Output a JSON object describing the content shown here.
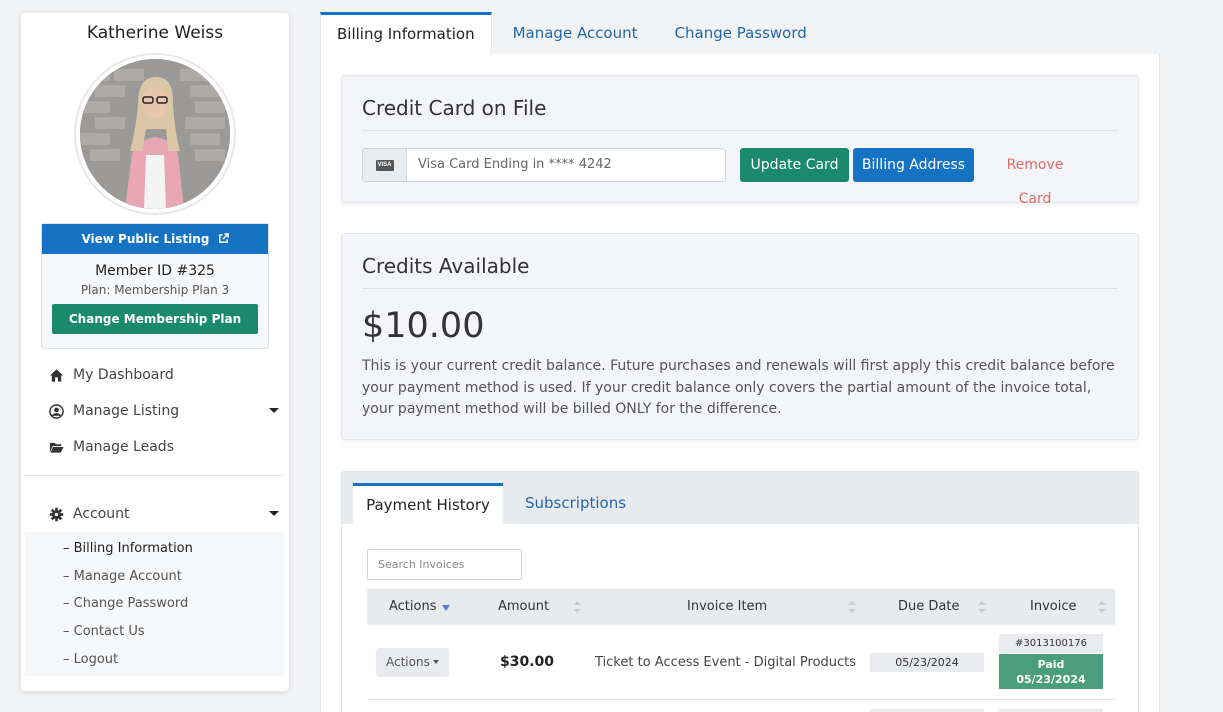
{
  "profile": {
    "name": "Katherine Weiss",
    "view_public_label": "View Public Listing",
    "member_id": "Member ID #325",
    "plan": "Plan: Membership Plan 3",
    "change_plan_label": "Change Membership Plan"
  },
  "nav": {
    "dashboard": "My Dashboard",
    "manage_listing": "Manage Listing",
    "manage_leads": "Manage Leads",
    "account": "Account",
    "sub_items": [
      "– Billing Information",
      "– Manage Account",
      "– Change Password",
      "– Contact Us",
      "– Logout"
    ]
  },
  "tabs": [
    "Billing Information",
    "Manage Account",
    "Change Password"
  ],
  "credit_card": {
    "title": "Credit Card on File",
    "card_icon_text": "VISA",
    "card_text": "Visa Card Ending in **** 4242",
    "update_label": "Update Card",
    "billing_label": "Billing Address",
    "remove_label": "Remove Card"
  },
  "credits": {
    "title": "Credits Available",
    "amount": "$10.00",
    "description": "This is your current credit balance. Future purchases and renewals will first apply this credit balance before your payment method is used. If your credit balance only covers the partial amount of the invoice total, your payment method will be billed ONLY for the difference."
  },
  "history": {
    "tabs": [
      "Payment History",
      "Subscriptions"
    ],
    "search_placeholder": "Search Invoices",
    "columns": [
      "Actions",
      "Amount",
      "Invoice Item",
      "Due Date",
      "Invoice"
    ],
    "rows": [
      {
        "action_label": "Actions",
        "amount": "$30.00",
        "item": "Ticket to Access Event - Digital Products",
        "due_date": "05/23/2024",
        "invoice_number": "#3013100176",
        "status": "Paid",
        "paid_date": "05/23/2024"
      }
    ]
  },
  "colors": {
    "primary_blue": "#1673c3",
    "green": "#1b8a6b",
    "paid_green": "#4a9e7e",
    "remove_red": "#e06a6a"
  }
}
